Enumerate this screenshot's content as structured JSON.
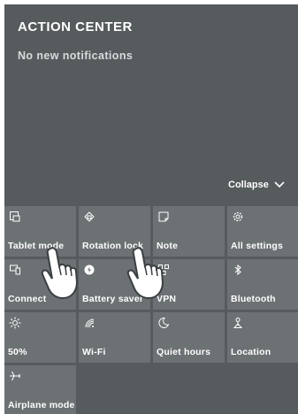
{
  "action_center": {
    "title": "ACTION CENTER",
    "empty_message": "No new notifications",
    "collapse_label": "Collapse"
  },
  "tiles": [
    {
      "label": "Tablet mode",
      "icon": "tablet-mode-icon"
    },
    {
      "label": "Rotation lock",
      "icon": "rotation-lock-icon"
    },
    {
      "label": "Note",
      "icon": "note-icon"
    },
    {
      "label": "All settings",
      "icon": "gear-icon"
    },
    {
      "label": "Connect",
      "icon": "connect-icon"
    },
    {
      "label": "Battery saver",
      "icon": "battery-saver-icon"
    },
    {
      "label": "VPN",
      "icon": "vpn-icon"
    },
    {
      "label": "Bluetooth",
      "icon": "bluetooth-icon"
    },
    {
      "label": "50%",
      "icon": "brightness-icon"
    },
    {
      "label": "Wi-Fi",
      "icon": "wifi-icon"
    },
    {
      "label": "Quiet hours",
      "icon": "moon-icon"
    },
    {
      "label": "Location",
      "icon": "location-icon"
    },
    {
      "label": "Airplane mode",
      "icon": "airplane-icon"
    }
  ],
  "colors": {
    "panel": "#565b5e",
    "tile": "#6c7174",
    "text": "#ffffff"
  }
}
